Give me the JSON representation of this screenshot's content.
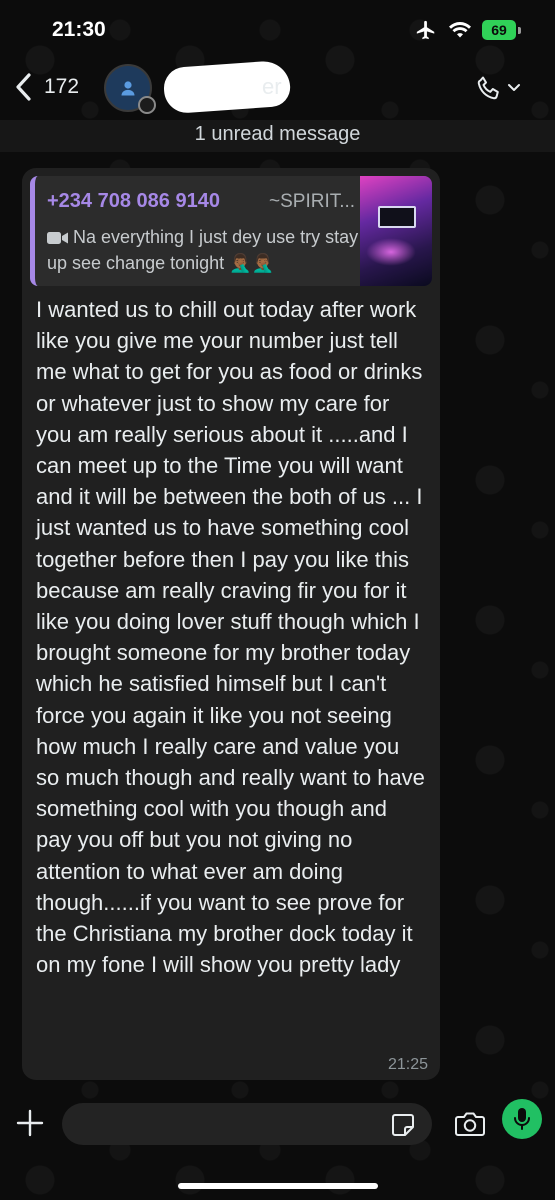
{
  "status_bar": {
    "time": "21:30",
    "battery_level": "69",
    "icons": [
      "airplane-icon",
      "wifi-icon",
      "battery-charging-icon"
    ],
    "battery_color": "#30d158"
  },
  "header": {
    "back_count": "172",
    "contact_name_visible_tail": "er",
    "icons": [
      "chevron-left-icon",
      "avatar-icon",
      "phone-icon",
      "chevron-down-icon"
    ]
  },
  "unread_banner": {
    "text": "1 unread message"
  },
  "message": {
    "quoted": {
      "author": "+234 708 086 9140",
      "push_name": "~SPIRIT...",
      "media_icon": "video-icon",
      "text": "Na everything I just dey use try stay up see change tonight 🤦🏾‍♂️🤦🏾‍♂️",
      "accent_color": "#a688e6"
    },
    "text": "I wanted us to chill out today after work like you give me your number just tell me what to get for you as food or drinks or whatever just to show my care for you am really serious about it .....and I can meet up to the Time you will want and it will be between the both of us ... I just wanted us to have something cool together before then I pay you like this because am really craving fir you for it like you doing lover stuff though which I brought someone for my brother today which he satisfied himself but I can't force you again it like you not seeing how much I really care and value you so much though and really want to have something cool with you though and pay you off but you not giving no attention to what ever am doing though......if you want to see prove for the Christiana my brother dock today it on my fone I will show you pretty lady",
    "time": "21:25",
    "bubble_color": "#202020"
  },
  "input_bar": {
    "value": "",
    "icons": [
      "plus-icon",
      "sticker-icon",
      "camera-icon",
      "microphone-icon"
    ],
    "mic_color": "#21c063"
  }
}
